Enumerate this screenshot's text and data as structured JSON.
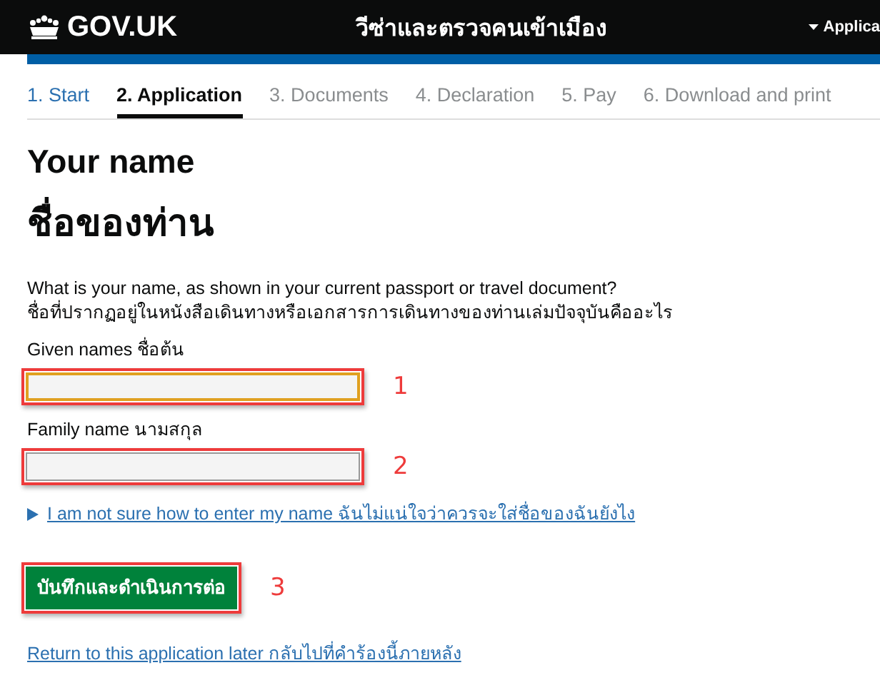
{
  "header": {
    "logo": "GOV.UK",
    "title": "วีซ่าและตรวจคนเข้าเมือง",
    "menu": "Applica"
  },
  "steps": [
    {
      "label": "1. Start",
      "completed": true,
      "selected": false
    },
    {
      "label": "2. Application",
      "completed": false,
      "selected": true
    },
    {
      "label": "3. Documents",
      "completed": false,
      "selected": false
    },
    {
      "label": "4. Declaration",
      "completed": false,
      "selected": false
    },
    {
      "label": "5. Pay",
      "completed": false,
      "selected": false
    },
    {
      "label": "6. Download and print",
      "completed": false,
      "selected": false
    }
  ],
  "heading": "Your name",
  "heading_thai": "ชื่อของท่าน",
  "question": [
    "What is your name, as shown in your current passport or travel document?",
    "ชื่อที่ปรากฏอยู่ในหนังสือเดินทางหรือเอกสารการเดินทางของท่านเล่มปัจจุบันคืออะไร"
  ],
  "fields": [
    {
      "label": "Given names ชื่อต้น",
      "focused": true,
      "marker": "1"
    },
    {
      "label": "Family name นามสกุล",
      "focused": false,
      "marker": "2"
    }
  ],
  "help_link": "I am not sure how to enter my name ฉันไม่แน่ใจว่าควรจะใส่ชื่อของฉันยังไง",
  "button": {
    "label": "บันทึกและดำเนินการต่อ",
    "marker": "3"
  },
  "return_link": "Return to this application later กลับไปที่คำร้องนี้ภายหลัง"
}
